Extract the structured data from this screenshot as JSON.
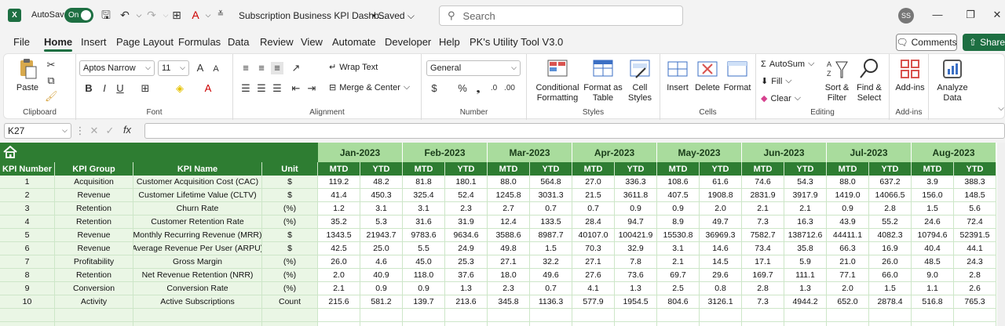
{
  "titlebar": {
    "app_letter": "X",
    "autosave_label": "AutoSave",
    "toggle_label": "On",
    "doc_title": "Subscription Business KPI Dashb...",
    "saved_label": "• Saved",
    "search_placeholder": "Search",
    "avatar_initials": "SS"
  },
  "menu": {
    "tabs": [
      "File",
      "Home",
      "Insert",
      "Page Layout",
      "Formulas",
      "Data",
      "Review",
      "View",
      "Automate",
      "Developer",
      "Help",
      "PK's Utility Tool V3.0"
    ],
    "active": "Home",
    "comments_label": "Comments",
    "share_label": "Share"
  },
  "ribbon": {
    "clipboard": {
      "paste": "Paste",
      "label": "Clipboard"
    },
    "font": {
      "family": "Aptos Narrow",
      "size": "11",
      "label": "Font"
    },
    "alignment": {
      "wrap": "Wrap Text",
      "merge": "Merge & Center",
      "label": "Alignment"
    },
    "number": {
      "format": "General",
      "label": "Number"
    },
    "styles": {
      "conditional": "Conditional",
      "conditional2": "Formatting",
      "format_as": "Format as",
      "format_as2": "Table",
      "cell": "Cell",
      "cell2": "Styles",
      "label": "Styles"
    },
    "cells": {
      "insert": "Insert",
      "delete": "Delete",
      "format": "Format",
      "label": "Cells"
    },
    "editing": {
      "autosum": "AutoSum",
      "fill": "Fill",
      "clear": "Clear",
      "sort": "Sort &",
      "sort2": "Filter",
      "find": "Find &",
      "find2": "Select",
      "label": "Editing"
    },
    "addins": {
      "addins": "Add-ins",
      "label": "Add-ins"
    },
    "analyze": {
      "line1": "Analyze",
      "line2": "Data"
    }
  },
  "formula_bar": {
    "name_box": "K27",
    "fx": "fx",
    "content": ""
  },
  "sheet": {
    "months": [
      "Jan-2023",
      "Feb-2023",
      "Mar-2023",
      "Apr-2023",
      "May-2023",
      "Jun-2023",
      "Jul-2023",
      "Aug-2023"
    ],
    "fixed_headers": [
      "KPI Number",
      "KPI Group",
      "KPI Name",
      "Unit"
    ],
    "sub_headers": [
      "MTD",
      "YTD"
    ],
    "rows": [
      {
        "num": "1",
        "group": "Acquisition",
        "name": "Customer Acquisition Cost (CAC)",
        "unit": "$",
        "vals": [
          "119.2",
          "48.2",
          "81.8",
          "180.1",
          "88.0",
          "564.8",
          "27.0",
          "336.3",
          "108.6",
          "61.6",
          "74.6",
          "54.3",
          "88.0",
          "637.2",
          "3.9",
          "388.3"
        ]
      },
      {
        "num": "2",
        "group": "Revenue",
        "name": "Customer Lifetime Value (CLTV)",
        "unit": "$",
        "vals": [
          "41.4",
          "450.3",
          "325.4",
          "52.4",
          "1245.8",
          "3031.3",
          "21.5",
          "3611.8",
          "407.5",
          "1908.8",
          "2831.9",
          "3917.9",
          "1419.0",
          "14066.5",
          "156.0",
          "148.5"
        ]
      },
      {
        "num": "3",
        "group": "Retention",
        "name": "Churn Rate",
        "unit": "(%)",
        "vals": [
          "1.2",
          "3.1",
          "3.1",
          "2.3",
          "2.7",
          "0.7",
          "0.7",
          "0.9",
          "0.9",
          "2.0",
          "2.1",
          "2.1",
          "0.9",
          "2.8",
          "1.5",
          "5.6"
        ]
      },
      {
        "num": "4",
        "group": "Retention",
        "name": "Customer Retention Rate",
        "unit": "(%)",
        "vals": [
          "35.2",
          "5.3",
          "31.6",
          "31.9",
          "12.4",
          "133.5",
          "28.4",
          "94.7",
          "8.9",
          "49.7",
          "7.3",
          "16.3",
          "43.9",
          "55.2",
          "24.6",
          "72.4"
        ]
      },
      {
        "num": "5",
        "group": "Revenue",
        "name": "Monthly Recurring Revenue (MRR)",
        "unit": "$",
        "vals": [
          "1343.5",
          "21943.7",
          "9783.6",
          "9634.6",
          "3588.6",
          "8987.7",
          "40107.0",
          "100421.9",
          "15530.8",
          "36969.3",
          "7582.7",
          "138712.6",
          "44411.1",
          "4082.3",
          "10794.6",
          "52391.5"
        ]
      },
      {
        "num": "6",
        "group": "Revenue",
        "name": "Average Revenue Per User (ARPU)",
        "unit": "$",
        "vals": [
          "42.5",
          "25.0",
          "5.5",
          "24.9",
          "49.8",
          "1.5",
          "70.3",
          "32.9",
          "3.1",
          "14.6",
          "73.4",
          "35.8",
          "66.3",
          "16.9",
          "40.4",
          "44.1"
        ]
      },
      {
        "num": "7",
        "group": "Profitability",
        "name": "Gross Margin",
        "unit": "(%)",
        "vals": [
          "26.0",
          "4.6",
          "45.0",
          "25.3",
          "27.1",
          "32.2",
          "27.1",
          "7.8",
          "2.1",
          "14.5",
          "17.1",
          "5.9",
          "21.0",
          "26.0",
          "48.5",
          "24.3"
        ]
      },
      {
        "num": "8",
        "group": "Retention",
        "name": "Net Revenue Retention (NRR)",
        "unit": "(%)",
        "vals": [
          "2.0",
          "40.9",
          "118.0",
          "37.6",
          "18.0",
          "49.6",
          "27.6",
          "73.6",
          "69.7",
          "29.6",
          "169.7",
          "111.1",
          "77.1",
          "66.0",
          "9.0",
          "2.8"
        ]
      },
      {
        "num": "9",
        "group": "Conversion",
        "name": "Conversion Rate",
        "unit": "(%)",
        "vals": [
          "2.1",
          "0.9",
          "0.9",
          "1.3",
          "2.3",
          "0.7",
          "4.1",
          "1.3",
          "2.5",
          "0.8",
          "2.8",
          "1.3",
          "2.0",
          "1.5",
          "1.1",
          "2.6"
        ]
      },
      {
        "num": "10",
        "group": "Activity",
        "name": "Active Subscriptions",
        "unit": "Count",
        "vals": [
          "215.6",
          "581.2",
          "139.7",
          "213.6",
          "345.8",
          "1136.3",
          "577.9",
          "1954.5",
          "804.6",
          "3126.1",
          "7.3",
          "4944.2",
          "652.0",
          "2878.4",
          "516.8",
          "765.3"
        ]
      }
    ]
  },
  "colors": {
    "excel_green": "#1d6f42",
    "header_green": "#2e7d32",
    "month_green": "#a9dc9d",
    "row_fill": "#eaf6e5"
  }
}
